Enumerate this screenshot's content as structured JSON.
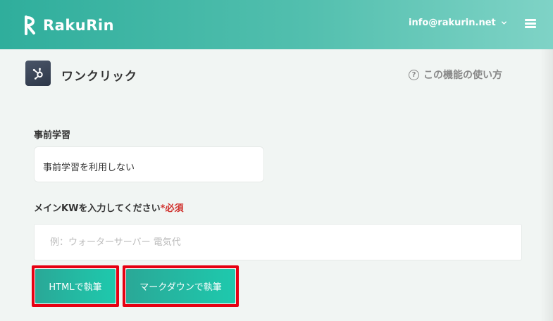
{
  "header": {
    "logo_text": "RakuRin",
    "account_email": "info@rakurin.net"
  },
  "page": {
    "title": "ワンクリック",
    "help_label": "この機能の使い方"
  },
  "form": {
    "pre_learning": {
      "label": "事前学習",
      "selected_value": "事前学習を利用しない"
    },
    "main_kw": {
      "label": "メインKWを入力してください",
      "required_mark": "*必須",
      "placeholder": "例：ウォーターサーバー 電気代",
      "value": ""
    }
  },
  "actions": {
    "html_button": "HTMLで執筆",
    "markdown_button": "マークダウンで執筆"
  },
  "colors": {
    "header_start": "#2fae9c",
    "header_end": "#7fd3c6",
    "button_start": "#2aa897",
    "button_end": "#1ec9ad",
    "highlight_border": "#e60012",
    "required": "#d0312d"
  },
  "icons": {
    "logo": "rakurin-logo-icon",
    "account_dropdown": "chevron-down-icon",
    "menu": "hamburger-menu-icon",
    "app": "hubspot-icon",
    "help": "question-circle-icon"
  }
}
